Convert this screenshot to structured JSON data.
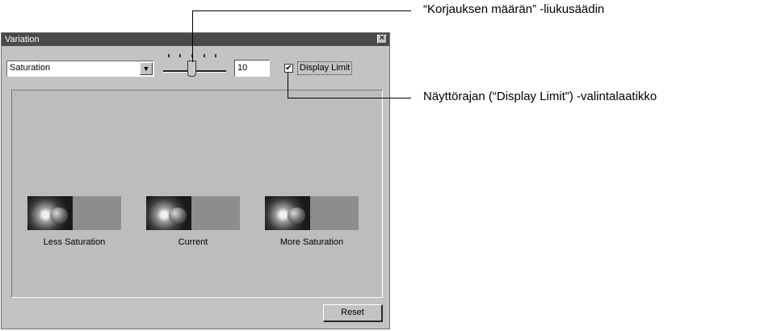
{
  "window": {
    "title": "Variation"
  },
  "controls": {
    "mode_select": "Saturation",
    "amount_value": "10",
    "display_limit_label": "Display Limit",
    "display_limit_checked": true
  },
  "previews": [
    {
      "label": "Less Saturation"
    },
    {
      "label": "Current"
    },
    {
      "label": "More Saturation"
    }
  ],
  "buttons": {
    "reset": "Reset"
  },
  "annotations": {
    "slider": "“Korjauksen määrän” -liukusäädin",
    "checkbox": "Näyttörajan (“Display Limit”) -valintalaatikko"
  }
}
